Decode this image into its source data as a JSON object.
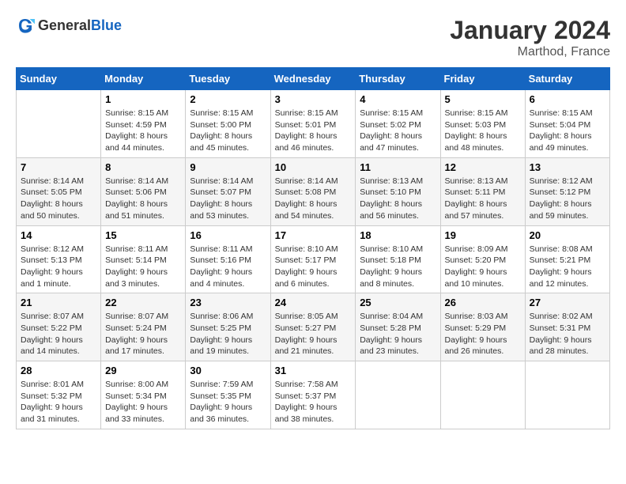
{
  "header": {
    "logo_general": "General",
    "logo_blue": "Blue",
    "title": "January 2024",
    "subtitle": "Marthod, France"
  },
  "days_of_week": [
    "Sunday",
    "Monday",
    "Tuesday",
    "Wednesday",
    "Thursday",
    "Friday",
    "Saturday"
  ],
  "weeks": [
    [
      {
        "day": "",
        "info": ""
      },
      {
        "day": "1",
        "info": "Sunrise: 8:15 AM\nSunset: 4:59 PM\nDaylight: 8 hours\nand 44 minutes."
      },
      {
        "day": "2",
        "info": "Sunrise: 8:15 AM\nSunset: 5:00 PM\nDaylight: 8 hours\nand 45 minutes."
      },
      {
        "day": "3",
        "info": "Sunrise: 8:15 AM\nSunset: 5:01 PM\nDaylight: 8 hours\nand 46 minutes."
      },
      {
        "day": "4",
        "info": "Sunrise: 8:15 AM\nSunset: 5:02 PM\nDaylight: 8 hours\nand 47 minutes."
      },
      {
        "day": "5",
        "info": "Sunrise: 8:15 AM\nSunset: 5:03 PM\nDaylight: 8 hours\nand 48 minutes."
      },
      {
        "day": "6",
        "info": "Sunrise: 8:15 AM\nSunset: 5:04 PM\nDaylight: 8 hours\nand 49 minutes."
      }
    ],
    [
      {
        "day": "7",
        "info": "Sunrise: 8:14 AM\nSunset: 5:05 PM\nDaylight: 8 hours\nand 50 minutes."
      },
      {
        "day": "8",
        "info": "Sunrise: 8:14 AM\nSunset: 5:06 PM\nDaylight: 8 hours\nand 51 minutes."
      },
      {
        "day": "9",
        "info": "Sunrise: 8:14 AM\nSunset: 5:07 PM\nDaylight: 8 hours\nand 53 minutes."
      },
      {
        "day": "10",
        "info": "Sunrise: 8:14 AM\nSunset: 5:08 PM\nDaylight: 8 hours\nand 54 minutes."
      },
      {
        "day": "11",
        "info": "Sunrise: 8:13 AM\nSunset: 5:10 PM\nDaylight: 8 hours\nand 56 minutes."
      },
      {
        "day": "12",
        "info": "Sunrise: 8:13 AM\nSunset: 5:11 PM\nDaylight: 8 hours\nand 57 minutes."
      },
      {
        "day": "13",
        "info": "Sunrise: 8:12 AM\nSunset: 5:12 PM\nDaylight: 8 hours\nand 59 minutes."
      }
    ],
    [
      {
        "day": "14",
        "info": "Sunrise: 8:12 AM\nSunset: 5:13 PM\nDaylight: 9 hours\nand 1 minute."
      },
      {
        "day": "15",
        "info": "Sunrise: 8:11 AM\nSunset: 5:14 PM\nDaylight: 9 hours\nand 3 minutes."
      },
      {
        "day": "16",
        "info": "Sunrise: 8:11 AM\nSunset: 5:16 PM\nDaylight: 9 hours\nand 4 minutes."
      },
      {
        "day": "17",
        "info": "Sunrise: 8:10 AM\nSunset: 5:17 PM\nDaylight: 9 hours\nand 6 minutes."
      },
      {
        "day": "18",
        "info": "Sunrise: 8:10 AM\nSunset: 5:18 PM\nDaylight: 9 hours\nand 8 minutes."
      },
      {
        "day": "19",
        "info": "Sunrise: 8:09 AM\nSunset: 5:20 PM\nDaylight: 9 hours\nand 10 minutes."
      },
      {
        "day": "20",
        "info": "Sunrise: 8:08 AM\nSunset: 5:21 PM\nDaylight: 9 hours\nand 12 minutes."
      }
    ],
    [
      {
        "day": "21",
        "info": "Sunrise: 8:07 AM\nSunset: 5:22 PM\nDaylight: 9 hours\nand 14 minutes."
      },
      {
        "day": "22",
        "info": "Sunrise: 8:07 AM\nSunset: 5:24 PM\nDaylight: 9 hours\nand 17 minutes."
      },
      {
        "day": "23",
        "info": "Sunrise: 8:06 AM\nSunset: 5:25 PM\nDaylight: 9 hours\nand 19 minutes."
      },
      {
        "day": "24",
        "info": "Sunrise: 8:05 AM\nSunset: 5:27 PM\nDaylight: 9 hours\nand 21 minutes."
      },
      {
        "day": "25",
        "info": "Sunrise: 8:04 AM\nSunset: 5:28 PM\nDaylight: 9 hours\nand 23 minutes."
      },
      {
        "day": "26",
        "info": "Sunrise: 8:03 AM\nSunset: 5:29 PM\nDaylight: 9 hours\nand 26 minutes."
      },
      {
        "day": "27",
        "info": "Sunrise: 8:02 AM\nSunset: 5:31 PM\nDaylight: 9 hours\nand 28 minutes."
      }
    ],
    [
      {
        "day": "28",
        "info": "Sunrise: 8:01 AM\nSunset: 5:32 PM\nDaylight: 9 hours\nand 31 minutes."
      },
      {
        "day": "29",
        "info": "Sunrise: 8:00 AM\nSunset: 5:34 PM\nDaylight: 9 hours\nand 33 minutes."
      },
      {
        "day": "30",
        "info": "Sunrise: 7:59 AM\nSunset: 5:35 PM\nDaylight: 9 hours\nand 36 minutes."
      },
      {
        "day": "31",
        "info": "Sunrise: 7:58 AM\nSunset: 5:37 PM\nDaylight: 9 hours\nand 38 minutes."
      },
      {
        "day": "",
        "info": ""
      },
      {
        "day": "",
        "info": ""
      },
      {
        "day": "",
        "info": ""
      }
    ]
  ]
}
